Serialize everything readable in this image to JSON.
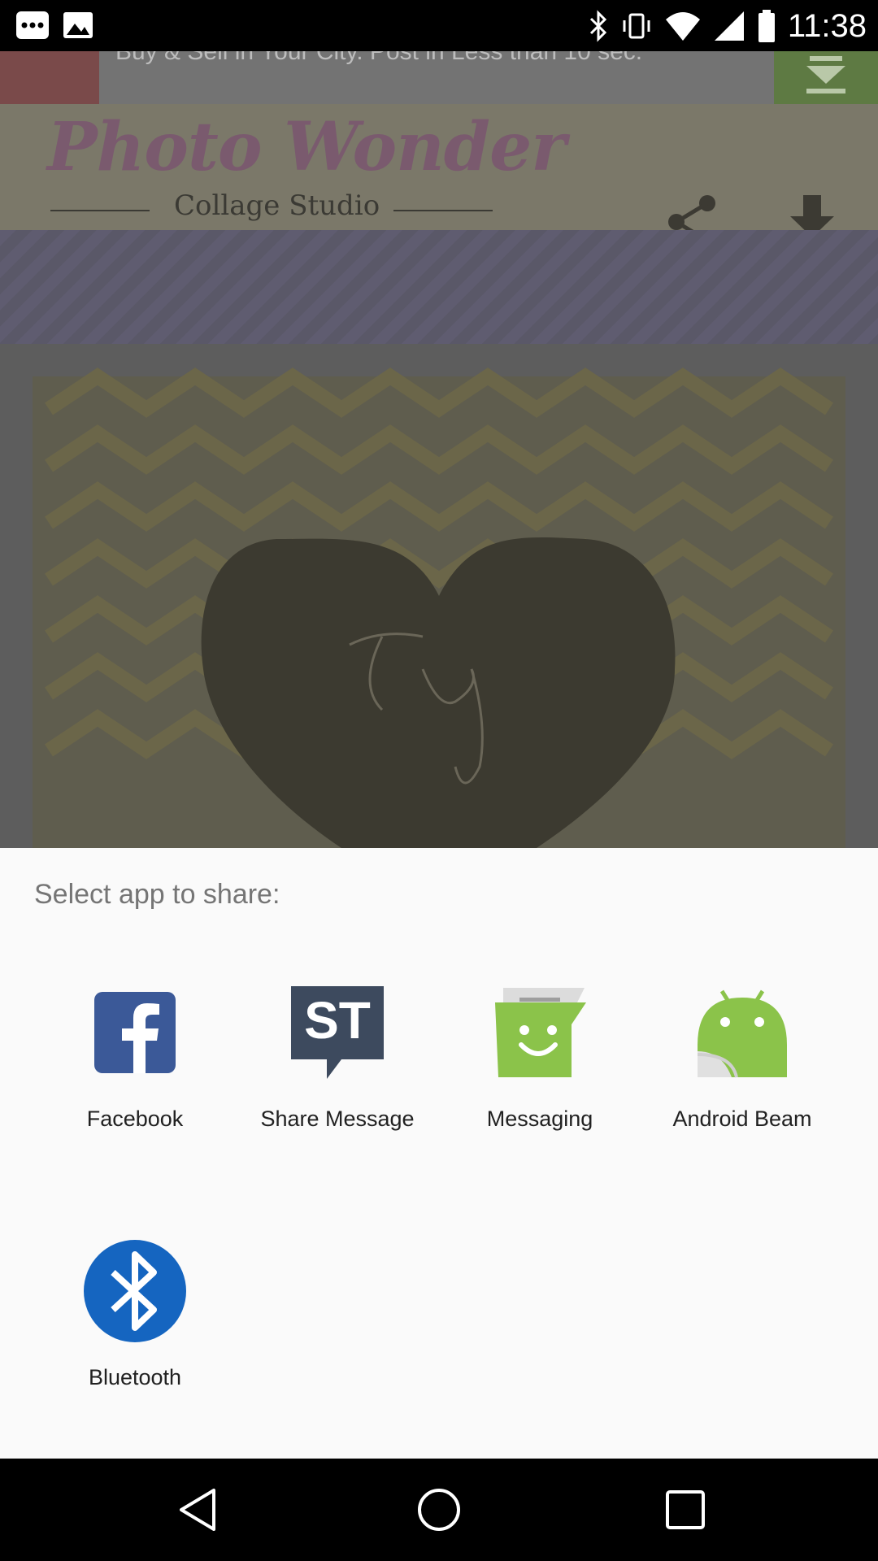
{
  "status_bar": {
    "time": "11:38",
    "icons": [
      "more-dots-icon",
      "image-icon",
      "bluetooth-icon",
      "vibrate-icon",
      "wifi-icon",
      "signal-icon",
      "battery-icon"
    ]
  },
  "background_app": {
    "ad_text": "Buy & Sell in Your City. Post in Less than 10 sec.",
    "title": "Photo Wonder",
    "subtitle": "Collage Studio",
    "share_icon": "share-icon",
    "download_icon": "download-icon"
  },
  "share_sheet": {
    "title": "Select app to share:",
    "apps": [
      {
        "label": "Facebook",
        "icon": "facebook-icon",
        "color": "#3b5998"
      },
      {
        "label": "Share Message",
        "icon": "share-message-icon",
        "color": "#3d4a5e"
      },
      {
        "label": "Messaging",
        "icon": "messaging-icon",
        "color": "#8bc34a"
      },
      {
        "label": "Android Beam",
        "icon": "android-beam-icon",
        "color": "#8bc34a"
      },
      {
        "label": "Bluetooth",
        "icon": "bluetooth-icon",
        "color": "#1565c0"
      }
    ]
  },
  "nav_bar": {
    "back": "back-icon",
    "home": "home-icon",
    "recents": "recents-icon"
  }
}
